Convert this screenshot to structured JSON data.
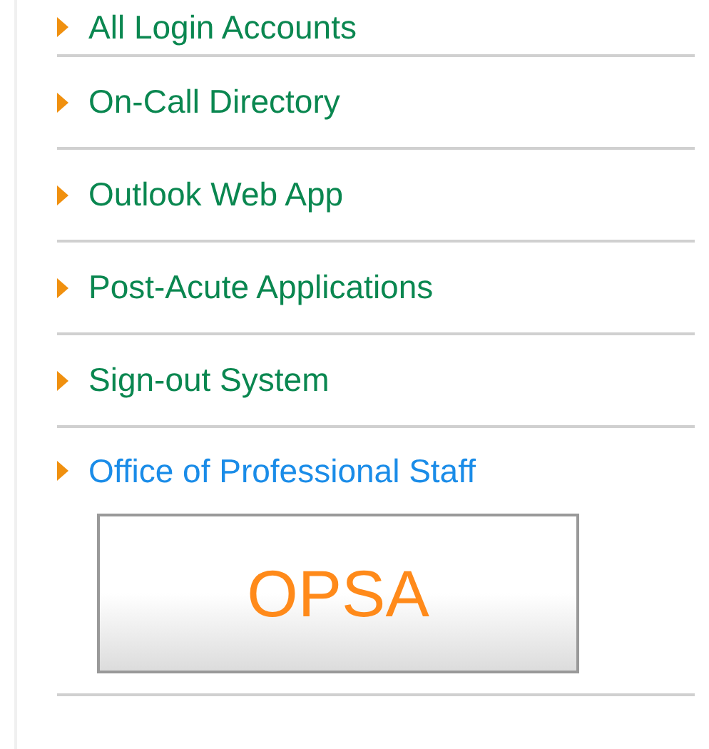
{
  "links": [
    {
      "label": "All Login Accounts",
      "color": "#0a8750"
    },
    {
      "label": "On-Call Directory",
      "color": "#0a8750"
    },
    {
      "label": "Outlook Web App",
      "color": "#0a8750"
    },
    {
      "label": "Post-Acute Applications",
      "color": "#0a8750"
    },
    {
      "label": "Sign-out System",
      "color": "#0a8750"
    },
    {
      "label": "Office of Professional Staff",
      "color": "#1a8ce8"
    }
  ],
  "badge": {
    "label": "OPSA"
  }
}
